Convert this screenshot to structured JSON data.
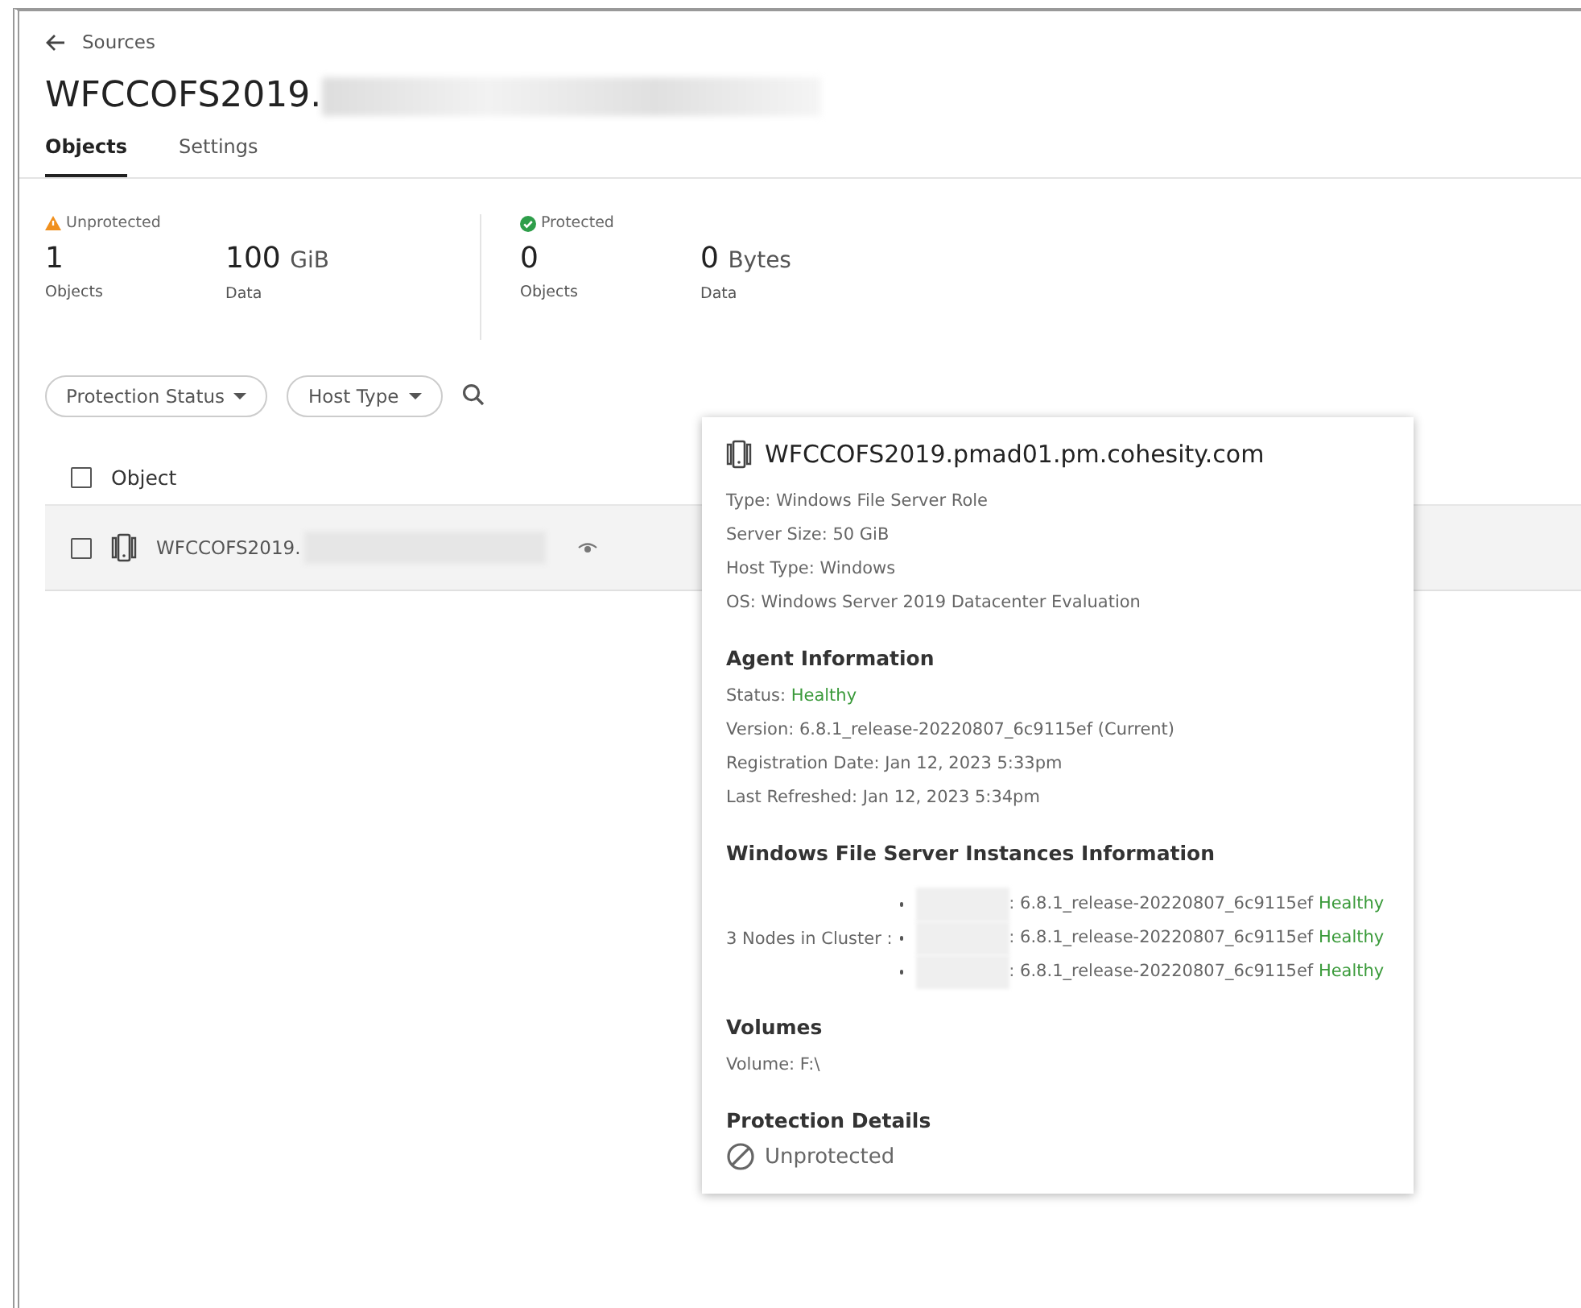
{
  "back_link": {
    "label": "Sources"
  },
  "title": "WFCCOFS2019.",
  "tabs": [
    {
      "label": "Objects",
      "selected": true
    },
    {
      "label": "Settings",
      "selected": false
    }
  ],
  "summary": [
    {
      "status": "Unprotected",
      "kind": "warning",
      "stats": [
        {
          "value": "1",
          "label": "Objects"
        },
        {
          "value": "100",
          "unit": "GiB",
          "label": "Data"
        }
      ]
    },
    {
      "status": "Protected",
      "kind": "ok",
      "stats": [
        {
          "value": "0",
          "label": "Objects"
        },
        {
          "value": "0",
          "unit": "Bytes",
          "label": "Data"
        }
      ]
    }
  ],
  "filters": [
    {
      "label": "Protection Status"
    },
    {
      "label": "Host Type"
    }
  ],
  "table": {
    "columns": [
      {
        "label": "Object",
        "checked": false
      }
    ],
    "rows": [
      {
        "name": "WFCCOFS2019.",
        "checked": false
      }
    ]
  },
  "popover": {
    "title": "WFCCOFS2019.pmad01.pm.cohesity.com",
    "details": [
      "Type: Windows File Server Role",
      "Server Size: 50 GiB",
      "Host Type: Windows",
      "OS: Windows Server 2019 Datacenter Evaluation"
    ],
    "agent": {
      "heading": "Agent Information",
      "lines": [
        {
          "text": "Status: ",
          "status": "Healthy"
        },
        {
          "text": "Version: 6.8.1_release-20220807_6c9115ef  (Current)"
        },
        {
          "text": "Registration Date: Jan 12, 2023 5:33pm"
        },
        {
          "text": "Last Refreshed: Jan 12, 2023 5:34pm"
        }
      ]
    },
    "instances": {
      "heading": "Windows File Server Instances Information",
      "label": "3 Nodes in Cluster :",
      "nodes": [
        {
          "version": ": 6.8.1_release-20220807_6c9115ef",
          "status": "Healthy"
        },
        {
          "version": ": 6.8.1_release-20220807_6c9115ef",
          "status": "Healthy"
        },
        {
          "version": ": 6.8.1_release-20220807_6c9115ef",
          "status": "Healthy"
        }
      ]
    },
    "volumes": {
      "heading": "Volumes",
      "lines": [
        "Volume: F:\\"
      ]
    },
    "protection": {
      "heading": "Protection Details",
      "status": "Unprotected"
    }
  }
}
